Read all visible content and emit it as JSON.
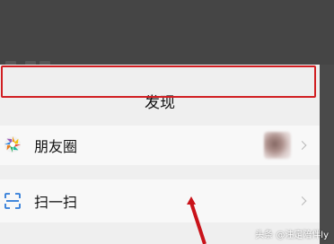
{
  "header": {
    "title": "发现"
  },
  "list": {
    "items": [
      {
        "label": "朋友圈",
        "icon": "moments-icon"
      },
      {
        "label": "扫一扫",
        "icon": "scan-icon"
      }
    ]
  },
  "watermark": {
    "text": "头条 @注定陪伴ly"
  },
  "colors": {
    "highlight": "#d11e22",
    "arrow": "#c9131a"
  }
}
